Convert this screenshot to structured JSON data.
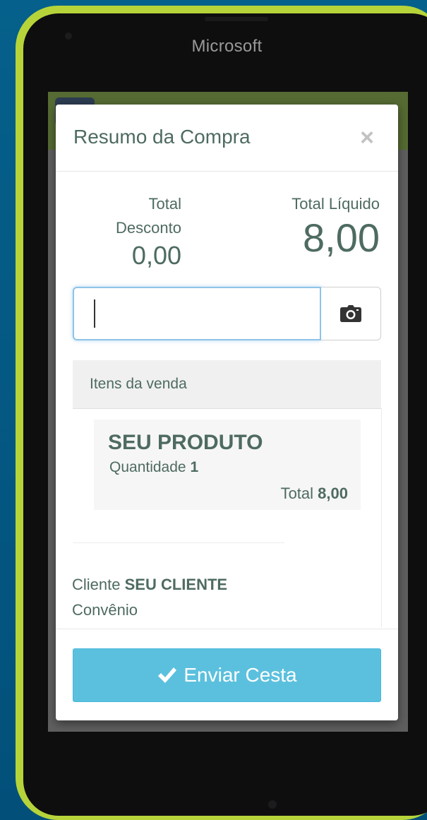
{
  "device": {
    "brand": "Microsoft"
  },
  "modal": {
    "title": "Resumo da Compra",
    "close_glyph": "×"
  },
  "totals": {
    "desconto_label_line1": "Total",
    "desconto_label_line2": "Desconto",
    "desconto_value": "0,00",
    "liquido_label": "Total Líquido",
    "liquido_value": "8,00"
  },
  "search": {
    "value": "",
    "placeholder": "",
    "camera_icon": "camera-icon"
  },
  "items_section": {
    "header": "Itens da venda",
    "items": [
      {
        "name": "SEU PRODUTO",
        "qty_label": "Quantidade",
        "qty_value": "1",
        "total_label": "Total",
        "total_value": "8,00"
      }
    ]
  },
  "client": {
    "label": "Cliente",
    "name": "SEU CLIENTE",
    "convenio_label": "Convênio"
  },
  "actions": {
    "send_label": "Enviar Cesta",
    "send_icon": "check-icon"
  },
  "colors": {
    "accent_button": "#5bc0de",
    "text_primary": "#4e6b60",
    "phone_outline": "#b6d43a",
    "background": "#04577f"
  }
}
